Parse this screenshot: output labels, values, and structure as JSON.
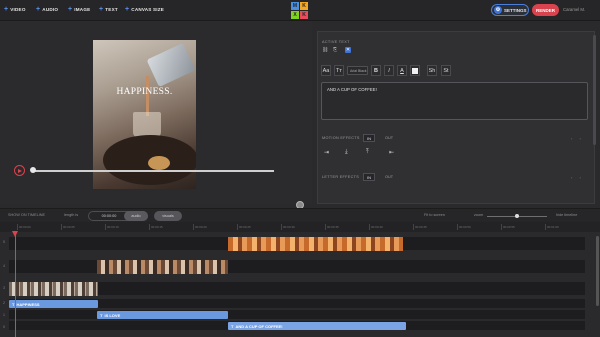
{
  "toolbar": {
    "items": [
      "VIDEO",
      "AUDIO",
      "IMAGE",
      "TEXT",
      "CANVAS SIZE"
    ],
    "logo_letters": [
      "M",
      "K",
      "X",
      "K"
    ],
    "logo_colors": [
      "#4a90e2",
      "#f5a623",
      "#7ed321",
      "#e94b5a"
    ],
    "settings_label": "SETTINGS",
    "render_label": "RENDER",
    "user_name": "Caramel M."
  },
  "preview": {
    "overlay_text": "HAPPINESS."
  },
  "panel": {
    "title": "ACTIVE TEXT",
    "font_select": "Arial Black",
    "format_buttons": [
      "Aa",
      "Tт",
      "B",
      "I",
      "A",
      "Sh",
      "St"
    ],
    "text_value": "AND A CUP OF COFFEE!",
    "motion_effects_label": "MOTION EFFECTS",
    "motion_in": "IN",
    "motion_out": "OUT",
    "letter_effects_label": "LETTER EFFECTS",
    "letter_in": "IN",
    "letter_out": "OUT"
  },
  "timeline": {
    "title": "SHOW ON TIMELINE",
    "length_label": "length is",
    "pill_off": "00:00:00",
    "pill_a": "audio",
    "pill_b": "visuals",
    "fit_label": "Fit to screen",
    "zoom_label": "zoom",
    "hide_label": "hide timeline",
    "ruler": [
      "00:00:00",
      "00:00:05",
      "00:00:10",
      "00:00:15",
      "00:00:20",
      "00:00:25",
      "00:00:30",
      "00:00:35",
      "00:00:40",
      "00:00:45",
      "00:00:50",
      "00:00:55",
      "00:01:00"
    ],
    "track_numbers": [
      "5",
      "4",
      "3",
      "2",
      "1",
      "0"
    ],
    "text_clips": [
      "HAPPINESS",
      "IS LOVE",
      "AND A CUP OF COFFEE!"
    ]
  }
}
